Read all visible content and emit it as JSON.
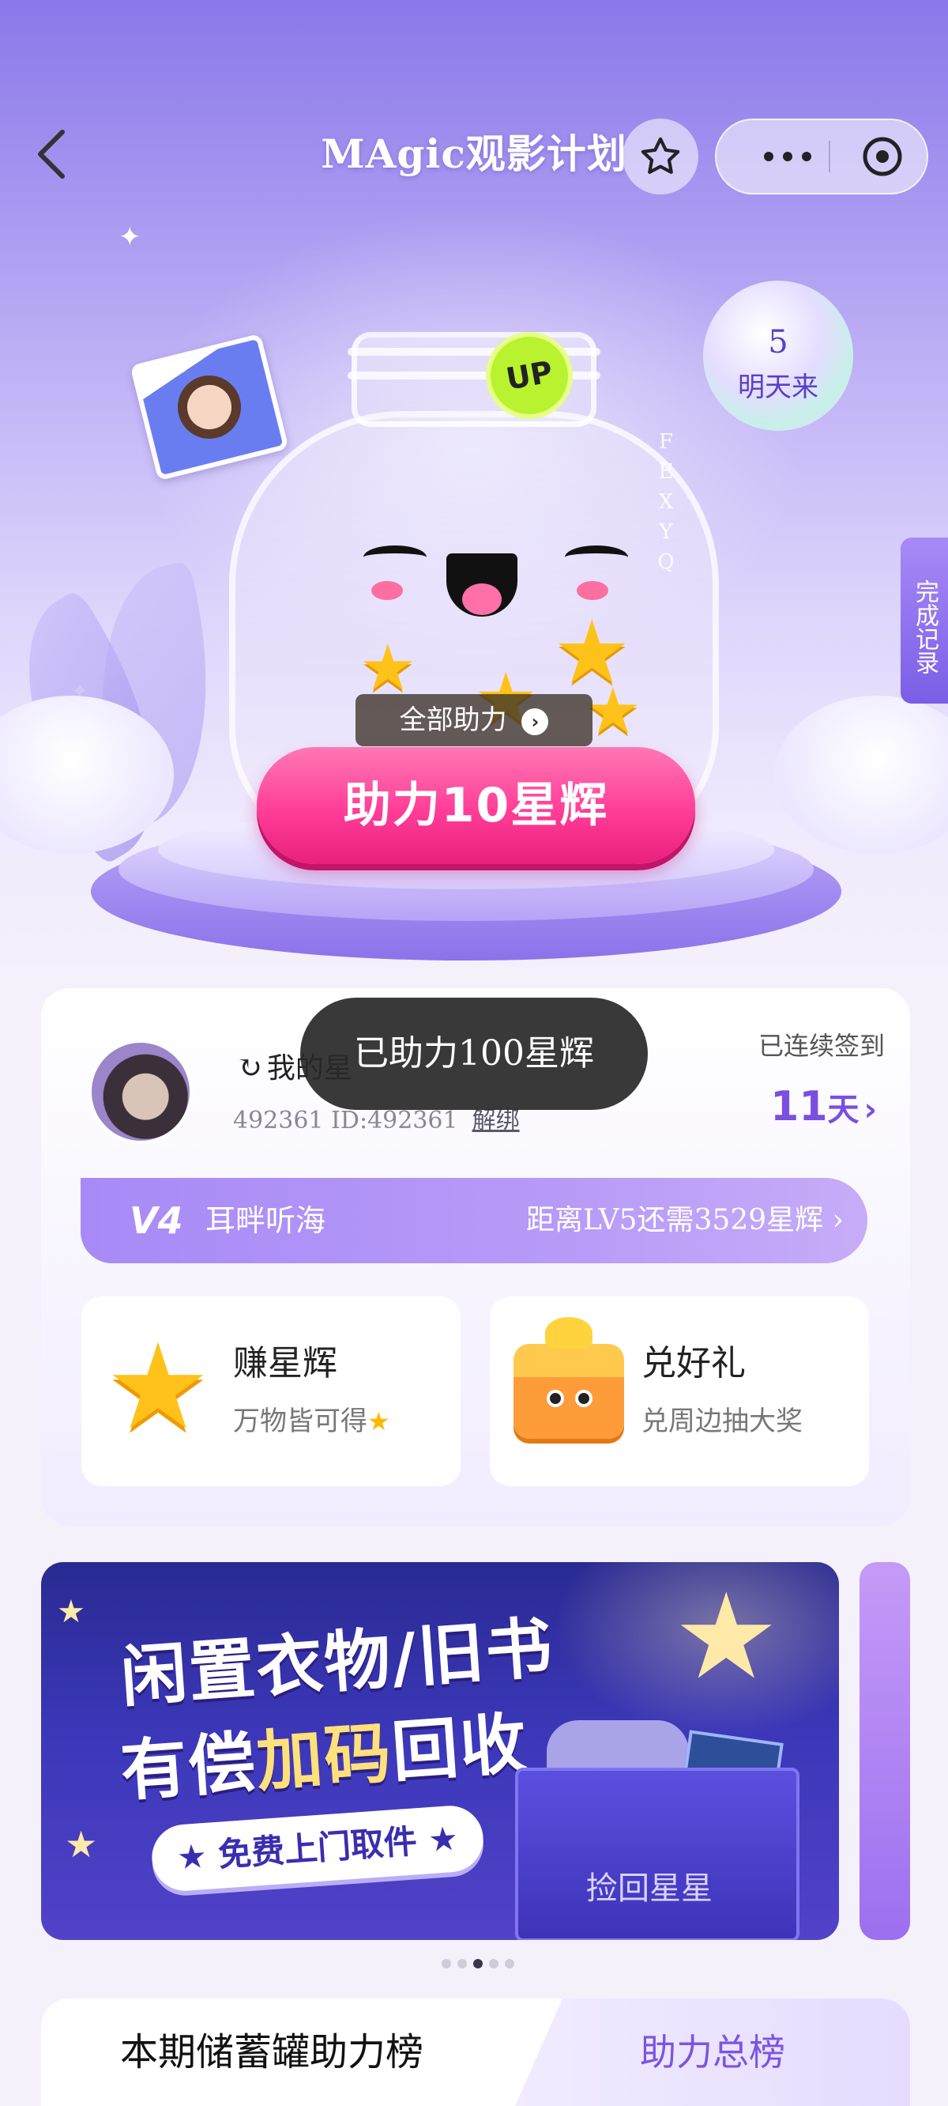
{
  "nav": {
    "title": "MAgic观影计划"
  },
  "hero": {
    "up_badge": "UP",
    "all_help_label": "全部助力",
    "help_button_label": "助力10星辉",
    "orb_number": "5",
    "orb_label": "明天来",
    "complete_records_label": "完成记录",
    "watermark_letters": [
      "F",
      "E",
      "X",
      "Y",
      "Q"
    ]
  },
  "toast": {
    "text": "已助力100星辉"
  },
  "user": {
    "name_line": "我的星",
    "id_line": "492361 ID:492361",
    "unbind_label": "解绑",
    "streak_label": "已连续签到",
    "streak_days": "11",
    "streak_unit": "天"
  },
  "level": {
    "badge": "V4",
    "name": "耳畔听海",
    "next_text": "距离LV5还需3529星辉"
  },
  "tiles": {
    "earn": {
      "title": "赚星辉",
      "subtitle": "万物皆可得"
    },
    "redeem": {
      "title": "兑好礼",
      "subtitle": "兑周边抽大奖"
    }
  },
  "banner": {
    "line1": "闲置衣物/旧书",
    "line2_a": "有偿",
    "line2_highlight": "加码",
    "line2_b": "回收",
    "pill": "★ 免费上门取件 ★",
    "box_text": "捡回星星"
  },
  "carousel": {
    "total": 5,
    "active_index": 2
  },
  "ranking": {
    "tab_active": "本期储蓄罐助力榜",
    "tab_other": "助力总榜"
  },
  "colors": {
    "accent": "#7a4fe0",
    "help_button": "#ff3d97",
    "level_bar": "#a88af7",
    "banner_bg": "#3b37b8"
  }
}
